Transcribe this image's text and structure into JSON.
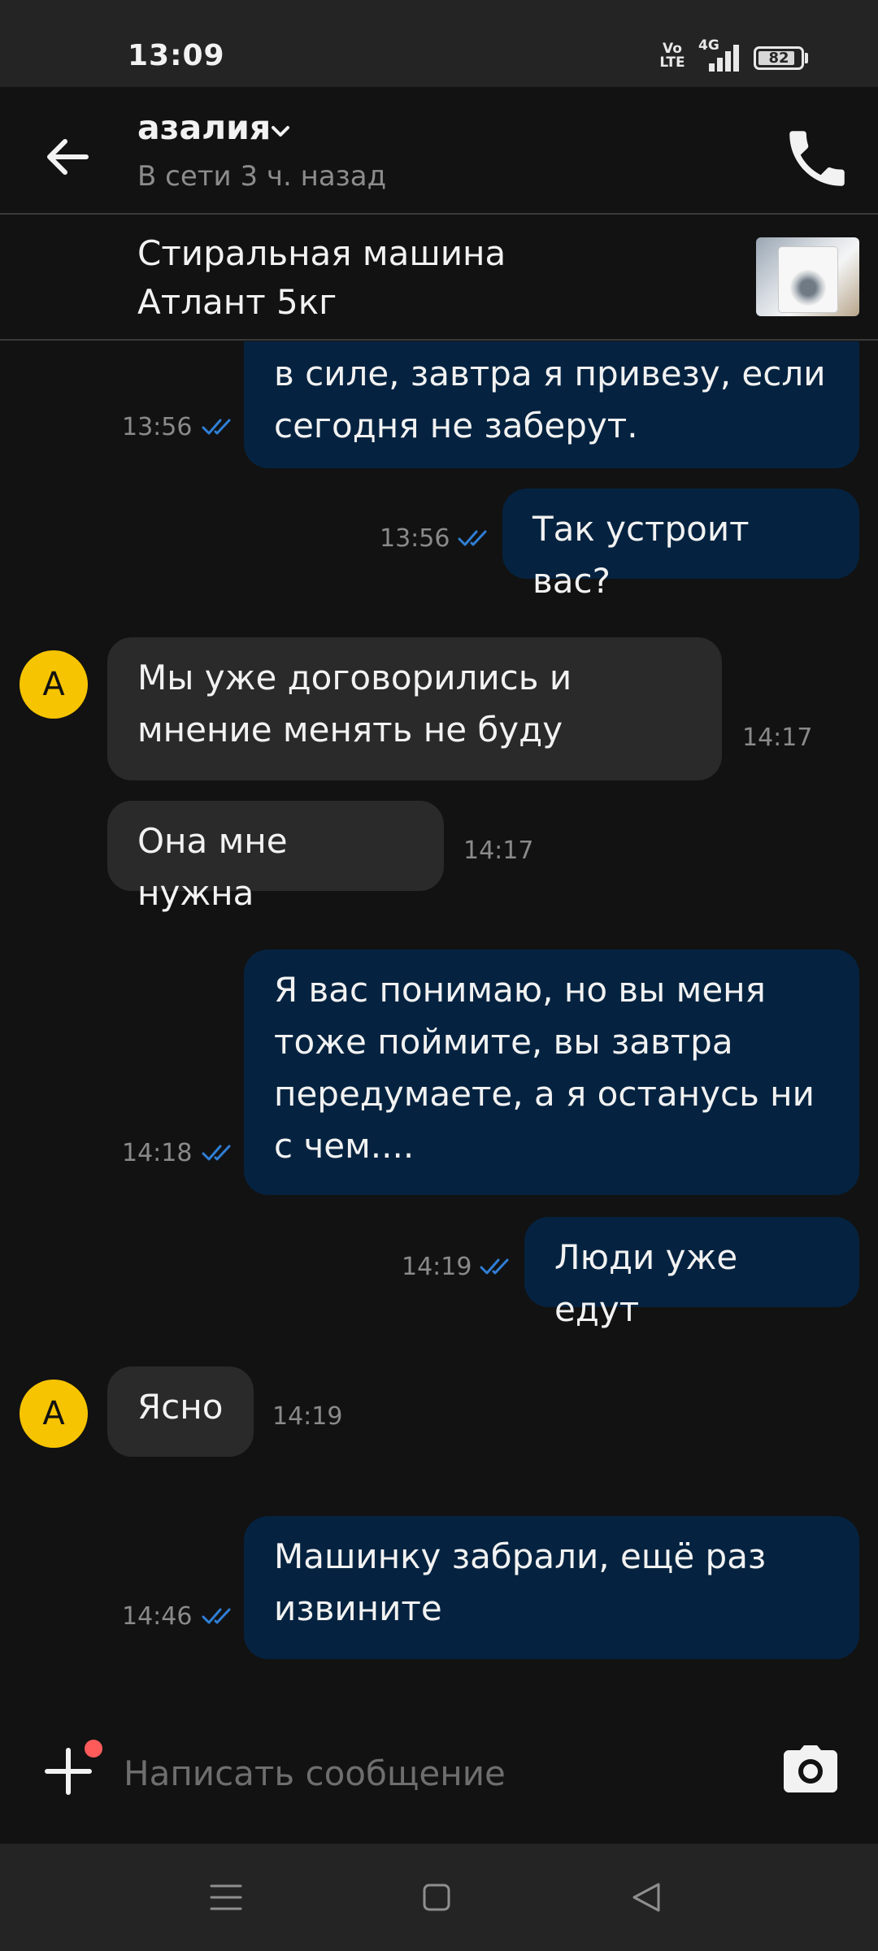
{
  "status_bar": {
    "time": "13:09",
    "volte": "Vo\nLTE",
    "network": "4G",
    "battery": "82"
  },
  "header": {
    "contact_name": "азалия",
    "last_seen": "В сети 3 ч. назад",
    "icons": [
      "back-arrow-icon",
      "chevron-down-icon",
      "phone-icon"
    ]
  },
  "listing": {
    "title": "Стиральная машина Атлант 5кг"
  },
  "messages": [
    {
      "direction": "out",
      "text": "в силе, завтра я привезу, если сегодня не заберут.",
      "time": "13:56",
      "read": true
    },
    {
      "direction": "out",
      "text": "Так устроит вас?",
      "time": "13:56",
      "read": true
    },
    {
      "direction": "in",
      "avatar": "А",
      "text": "Мы уже договорились и мнение менять не буду",
      "time": "14:17"
    },
    {
      "direction": "in",
      "text": "Она мне нужна",
      "time": "14:17"
    },
    {
      "direction": "out",
      "text": "Я вас понимаю, но вы меня тоже поймите, вы завтра передумаете, а я останусь ни с чем....",
      "time": "14:18",
      "read": true
    },
    {
      "direction": "out",
      "text": "Люди уже едут",
      "time": "14:19",
      "read": true
    },
    {
      "direction": "in",
      "avatar": "А",
      "text": "Ясно",
      "time": "14:19"
    },
    {
      "direction": "out",
      "text": "Машинку забрали, ещё раз извините",
      "time": "14:46",
      "read": true
    }
  ],
  "composer": {
    "placeholder": "Написать сообщение"
  },
  "colors": {
    "background": "#121212",
    "outgoing_bubble": "#052340",
    "incoming_bubble": "#2a2a2a",
    "avatar": "#f6c400",
    "read_ticks": "#2f7fd6",
    "notification_dot": "#ff5b5b"
  }
}
